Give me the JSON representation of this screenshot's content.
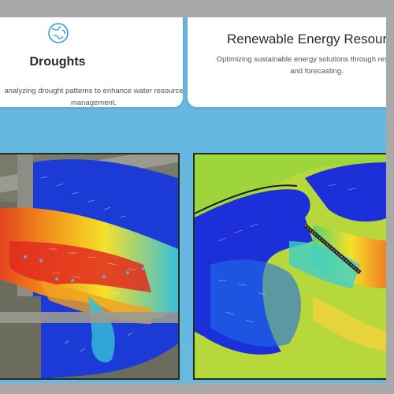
{
  "cards": [
    {
      "title": "Droughts",
      "description_line1": "analyzing drought patterns to enhance water resource",
      "description_line2": "management.",
      "icon": "globe-icon"
    },
    {
      "title": "Renewable Energy Resources",
      "description_line1": "Optimizing sustainable energy solutions through resource as",
      "description_line2": "and forecasting."
    }
  ],
  "images": [
    {
      "name": "flood-velocity-map",
      "description": ""
    },
    {
      "name": "dam-flow-simulation",
      "description": ""
    }
  ],
  "colors": {
    "background": "#66b8e0",
    "card": "#ffffff",
    "icon": "#3a9ad9"
  }
}
